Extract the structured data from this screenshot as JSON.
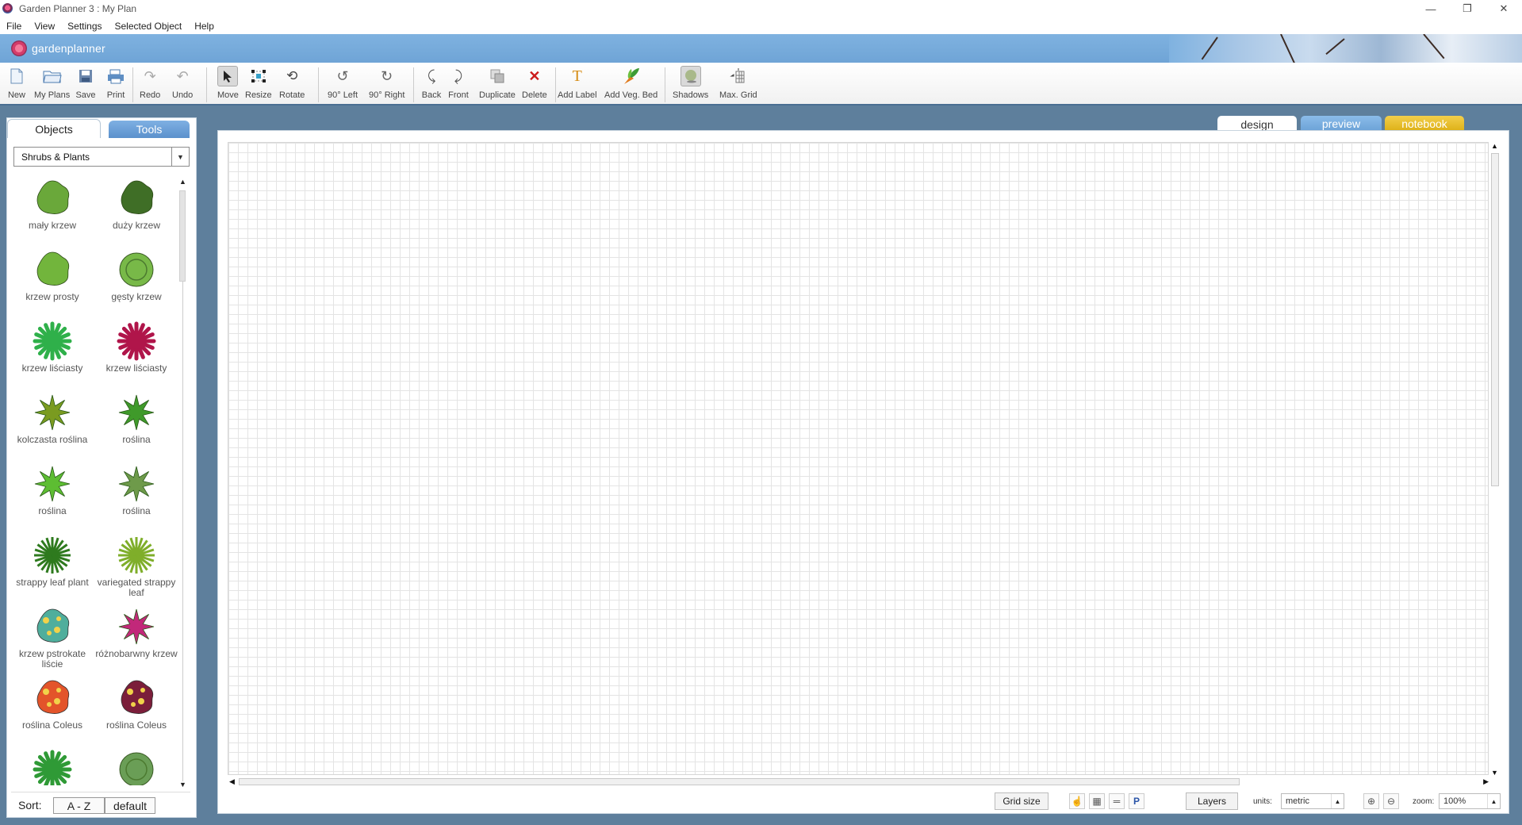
{
  "window": {
    "title": "Garden Planner 3 : My  Plan",
    "controls": [
      "—",
      "❐",
      "✕"
    ]
  },
  "menu": [
    "File",
    "View",
    "Settings",
    "Selected Object",
    "Help"
  ],
  "brand": {
    "name": "gardenplanner"
  },
  "toolbar": {
    "new": "New",
    "my_plans": "My Plans",
    "save": "Save",
    "print": "Print",
    "redo": "Redo",
    "undo": "Undo",
    "move": "Move",
    "resize": "Resize",
    "rotate": "Rotate",
    "left90": "90° Left",
    "right90": "90° Right",
    "back": "Back",
    "front": "Front",
    "duplicate": "Duplicate",
    "delete": "Delete",
    "add_label": "Add Label",
    "add_veg_bed": "Add Veg. Bed",
    "shadows": "Shadows",
    "max_grid": "Max. Grid"
  },
  "panel_tabs": {
    "objects": "Objects",
    "tools": "Tools"
  },
  "category": {
    "selected": "Shrubs & Plants"
  },
  "plants": [
    {
      "label": "mały krzew",
      "color": "#6aa83a"
    },
    {
      "label": "duży krzew",
      "color": "#3f6e26"
    },
    {
      "label": "krzew prosty",
      "color": "#72b53c"
    },
    {
      "label": "gęsty krzew",
      "color": "#78b948"
    },
    {
      "label": "krzew liściasty",
      "color": "#2fb04a"
    },
    {
      "label": "krzew liściasty",
      "color": "#b0154a"
    },
    {
      "label": "kolczasta roślina",
      "color": "#7a9b20"
    },
    {
      "label": "roślina",
      "color": "#3f9a2a"
    },
    {
      "label": "roślina",
      "color": "#5dbd32"
    },
    {
      "label": "roślina",
      "color": "#6e9a4a"
    },
    {
      "label": "strappy leaf plant",
      "color": "#2e7a1e"
    },
    {
      "label": "variegated strappy leaf",
      "color": "#7fae2a"
    },
    {
      "label": "krzew pstrokate liście",
      "color": "#4fae9c"
    },
    {
      "label": "różnobarwny krzew",
      "color": "#c2287a"
    },
    {
      "label": "roślina Coleus",
      "color": "#e3542a"
    },
    {
      "label": "roślina Coleus",
      "color": "#7b1e3a"
    },
    {
      "label": "",
      "color": "#2f9a36"
    },
    {
      "label": "",
      "color": "#6a9e56"
    }
  ],
  "sort": {
    "label": "Sort:",
    "az": "A - Z",
    "default": "default"
  },
  "view_tabs": {
    "design": "design",
    "preview": "preview",
    "notebook": "notebook"
  },
  "bottom": {
    "grid_size": "Grid size",
    "layers": "Layers",
    "units_label": "units:",
    "units_value": "metric",
    "zoom_label": "zoom:",
    "zoom_value": "100%"
  }
}
